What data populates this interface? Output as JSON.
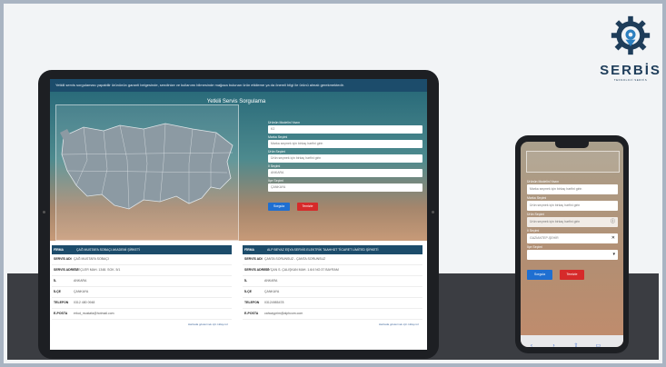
{
  "brand": {
    "name": "SERBİS",
    "tagline": "TEKNOLOJİ SERVİS",
    "colors": {
      "primary": "#1e3d5a",
      "accent": "#2c7fbf"
    }
  },
  "tablet": {
    "topbar_text": "Yetkili servis sorgulaması yapabilir ürününün garanti belgesinde, sendinize ve kullanımı bilmesinde mağaza bulunan ürün etkileme ya da önemli bilgi ile ürünü almalı gerekmektedir.",
    "title": "Yetkili Servis Sorgulama",
    "form": [
      {
        "label": "Ürünün Modelini Yazın",
        "value": "K2"
      },
      {
        "label": "Marka Seçimi",
        "value": "Marka seçmek için birkaç harfini girin"
      },
      {
        "label": "Ürün Seçimi",
        "value": "Ürün seçmek için birkaç harfini girin"
      },
      {
        "label": "İl Seçimi",
        "value": "ANKARA"
      },
      {
        "label": "İlçe Seçimi",
        "value": "ÇANKAYA"
      }
    ],
    "search_label": "Sorgula",
    "clear_label": "Temizle",
    "results": [
      {
        "header_left": "FİRMA",
        "header_right": "ÇAĞ MUSTAFA SOBAÇI AKADEMİ ŞİRKETİ",
        "rows": [
          {
            "k": "SERVİS ADI",
            "v": "ÇAĞ MUSTAFA SOBAÇI"
          },
          {
            "k": "SERVİS ADRESİ",
            "v": "ÖVEÇLER MAH. 1348. SOK. 5/1"
          },
          {
            "k": "İL",
            "v": "ANKARA"
          },
          {
            "k": "İLÇE",
            "v": "ÇANKAYA"
          },
          {
            "k": "TELEFON",
            "v": "0312 480 0948"
          },
          {
            "k": "E-POSTA",
            "v": "erkut_mustafa@hotmail.com"
          }
        ],
        "footer": "Haritada göstermek için tıklayınız"
      },
      {
        "header_left": "FİRMA",
        "header_right": "ALP BEYAZ EŞYA SERVİS ELEKTRİK TAAHHÜT TİCARET LİMİTED ŞİRKETİ",
        "rows": [
          {
            "k": "SERVİS ADI",
            "v": "ÇANTA SORUNSUZ - ÇANTA SORUNSUZ"
          },
          {
            "k": "SERVİS ADRESİ",
            "v": "BAYÇAN S. ÇALIŞKAN MAH. 1.6/4 NO:37 BAYRAM"
          },
          {
            "k": "İL",
            "v": "ANKARA"
          },
          {
            "k": "İLÇE",
            "v": "ÇANKAYA"
          },
          {
            "k": "TELEFON",
            "v": "03124985478"
          },
          {
            "k": "E-POSTA",
            "v": "cahcayprim@alphcom.com"
          }
        ],
        "footer": "Haritada göstermek için tıklayınız"
      }
    ]
  },
  "phone": {
    "form": [
      {
        "label": "Ürünün Modelini Yazın",
        "value": "Marka seçmek için birkaç harfini girin"
      },
      {
        "label": "Marka Seçimi",
        "value": "Ürün seçmek için birkaç harfini girin"
      },
      {
        "label": "Ürün Seçimi",
        "value": "Ürün seçmek için birkaç harfini girin"
      },
      {
        "label": "İl Seçimi",
        "value": "GAZİANTEP-ŞEHİR"
      },
      {
        "label": "İlçe Seçimi",
        "value": ""
      }
    ],
    "search_label": "Sorgula",
    "clear_label": "Temizle",
    "toolbar_icons": [
      "back-icon",
      "forward-icon",
      "share-icon",
      "bookmarks-icon",
      "tabs-icon"
    ]
  }
}
